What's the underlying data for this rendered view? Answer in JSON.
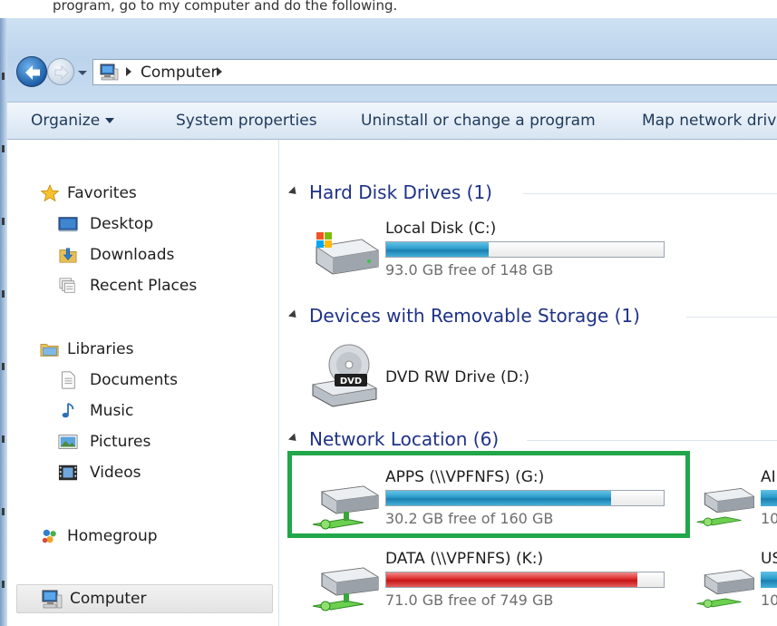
{
  "doc_fragment": "program, go to my computer and do the following.",
  "address": {
    "crumb": "Computer"
  },
  "toolbar": {
    "organize": "Organize",
    "system_properties": "System properties",
    "uninstall": "Uninstall or change a program",
    "map_drive": "Map network drive"
  },
  "nav": {
    "favorites": "Favorites",
    "desktop": "Desktop",
    "downloads": "Downloads",
    "recent": "Recent Places",
    "libraries": "Libraries",
    "documents": "Documents",
    "music": "Music",
    "pictures": "Pictures",
    "videos": "Videos",
    "homegroup": "Homegroup",
    "computer": "Computer"
  },
  "groups": {
    "hdd": "Hard Disk Drives (1)",
    "removable": "Devices with Removable Storage (1)",
    "network": "Network Location (6)"
  },
  "drives": {
    "c": {
      "name": "Local Disk (C:)",
      "free": "93.0 GB free of 148 GB",
      "used_fraction": 0.37
    },
    "d": {
      "name": "DVD RW Drive (D:)",
      "dvd_label": "DVD"
    },
    "g": {
      "name": "APPS (\\\\VPFNFS) (G:)",
      "free": "30.2 GB free of 160 GB",
      "used_fraction": 0.81
    },
    "k": {
      "name": "DATA (\\\\VPFNFS) (K:)",
      "free": "71.0 GB free of 749 GB",
      "used_fraction": 0.905
    },
    "partial1": {
      "name": "AI",
      "free": "10"
    },
    "partial2": {
      "name": "US",
      "free": "10"
    }
  },
  "colors": {
    "highlight": "#21a64a",
    "bar_blue": "#2a9ccb",
    "bar_red": "#db2a2a"
  }
}
